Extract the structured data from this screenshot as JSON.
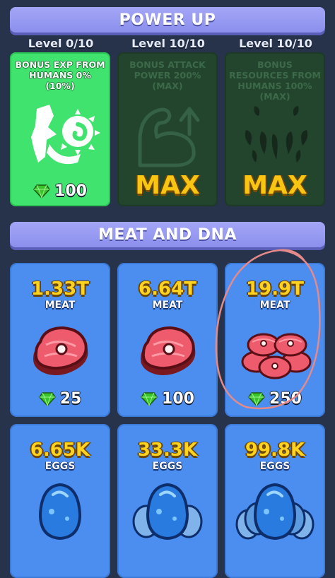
{
  "power_up": {
    "title": "POWER UP",
    "cards": [
      {
        "level": "Level 0/10",
        "title": "BONUS EXP FROM HUMANS 0% (10%)",
        "state": "active",
        "icon": "exp-scroll-icon",
        "cost": "100"
      },
      {
        "level": "Level 10/10",
        "title": "BONUS ATTACK POWER 200% (MAX)",
        "state": "maxed",
        "icon": "flexed-arm-icon",
        "max_label": "MAX"
      },
      {
        "level": "Level 10/10",
        "title": "BONUS RESOURCES FROM HUMANS 100% (MAX)",
        "state": "maxed",
        "icon": "fangs-icon",
        "max_label": "MAX"
      }
    ]
  },
  "meat_and_dna": {
    "title": "MEAT AND DNA",
    "items": [
      {
        "amount": "1.33T",
        "unit": "MEAT",
        "icon": "steak-icon",
        "cost": "25"
      },
      {
        "amount": "6.64T",
        "unit": "MEAT",
        "icon": "steak-icon",
        "cost": "100"
      },
      {
        "amount": "19.9T",
        "unit": "MEAT",
        "icon": "steak-pile-icon",
        "cost": "250"
      },
      {
        "amount": "6.65K",
        "unit": "EGGS",
        "icon": "egg-icon"
      },
      {
        "amount": "33.3K",
        "unit": "EGGS",
        "icon": "egg-cluster-icon"
      },
      {
        "amount": "99.8K",
        "unit": "EGGS",
        "icon": "egg-pile-icon"
      }
    ]
  },
  "colors": {
    "background": "#27334a",
    "banner": "#9a9df2",
    "active_card": "#3fe36d",
    "maxed_card": "#23442d",
    "shop_card": "#4b8ef0",
    "gold_text": "#ffd21f",
    "gem": "#4ddb3a",
    "annotation_circle": "#e58a8a"
  }
}
